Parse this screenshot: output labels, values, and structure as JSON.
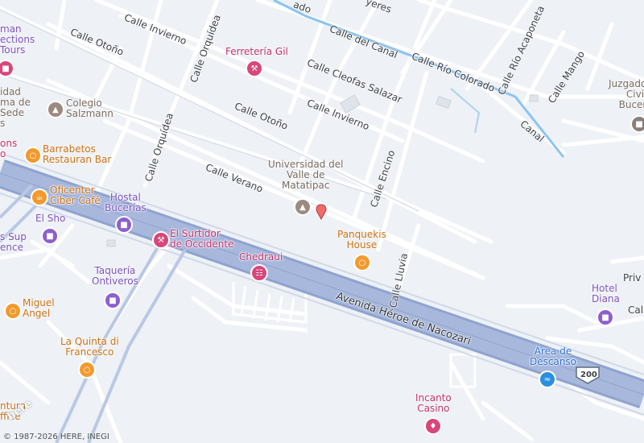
{
  "map": {
    "attribution": "© 1987-2026 HERE, INEGI",
    "logo": "here",
    "route_shield": "200",
    "marker_icon": "location-pin-icon",
    "colors": {
      "background": "#eef1f5",
      "minor_road": "#ffffff",
      "highway": "#9aaed6",
      "canal": "#8cc4f0",
      "food_poi": "#f29a2e",
      "shop_poi": "#d8467a",
      "hotel_poi": "#8d5fcf",
      "edu_poi": "#9c8a7f",
      "marker": "#f26b6b"
    }
  },
  "streets": {
    "calle_otono_1": "Calle Otoño",
    "calle_invierno_1": "Calle Invierno",
    "calle_orquidea_1": "Calle Orquídea",
    "calle_del_canal": "Calle del Canal",
    "calle_rio_colorado": "Calle Río Colorado",
    "calle_rio_acaponeta": "Calle Río Acaponeta",
    "calle_mango": "Calle Mango",
    "calle_cleofas": "Calle Cleofas Salazar",
    "calle_invierno_2": "Calle Invierno",
    "calle_otono_2": "Calle Otoño",
    "canal": "Canal",
    "calle_orquidea_2": "Calle Orquídea",
    "calle_verano": "Calle Verano",
    "calle_encino": "Calle Encino",
    "calle_lluvia": "Calle Lluvia",
    "avenida": "Avenida Héroe de Nacozari",
    "priv": "Priv",
    "calle_right": "Call",
    "jyeres": "yeres",
    "ado": "ado"
  },
  "pois": {
    "ferreteria": "Ferretería Gil",
    "colegio": "Colegio\nSalzmann",
    "barrabetos": "Barrabetos\nRestauran Bar",
    "universidad": "Universidad del\nValle de\nMatatipac",
    "oficenter": "Oficenter\nCiber Café",
    "hostal": "Hostal\nBucerías",
    "el_sho": "El Sho",
    "surtidor": "El Surtidor\nde Occidente",
    "chedraui": "Chedraui",
    "panquekis": "Panquekis\nHouse",
    "taqueria": "Taquería\nOntiveros",
    "miguel": "Miguel\nAngel",
    "la_quinta": "La Quinta di\nFrancesco",
    "area_descanso": "Área de\nDescanso",
    "incanto": "Incanto\nCasino",
    "hotel_diana": "Hotel\nDiana",
    "juzgado": "Juzgado\nCivil\nBucer",
    "ventura": "ntura\nffice",
    "sup": "s Sup\nence",
    "man_sections": "man\nections\nTours",
    "udad": "idad\nma de\nSede\ns",
    "ons": "ons\no"
  }
}
